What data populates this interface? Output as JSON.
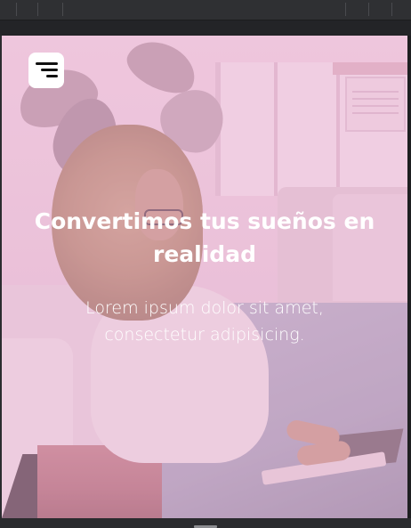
{
  "hero": {
    "title": "Convertimos tus sueños en realidad",
    "subtitle": "Lorem ipsum dolor sit amet, consectetur adipisicing."
  },
  "menu_button": {
    "icon": "hamburger-menu-icon"
  },
  "colors": {
    "overlay": "#e8aacd",
    "text": "#ffffff",
    "button_bg": "#ffffff",
    "icon": "#111111"
  }
}
